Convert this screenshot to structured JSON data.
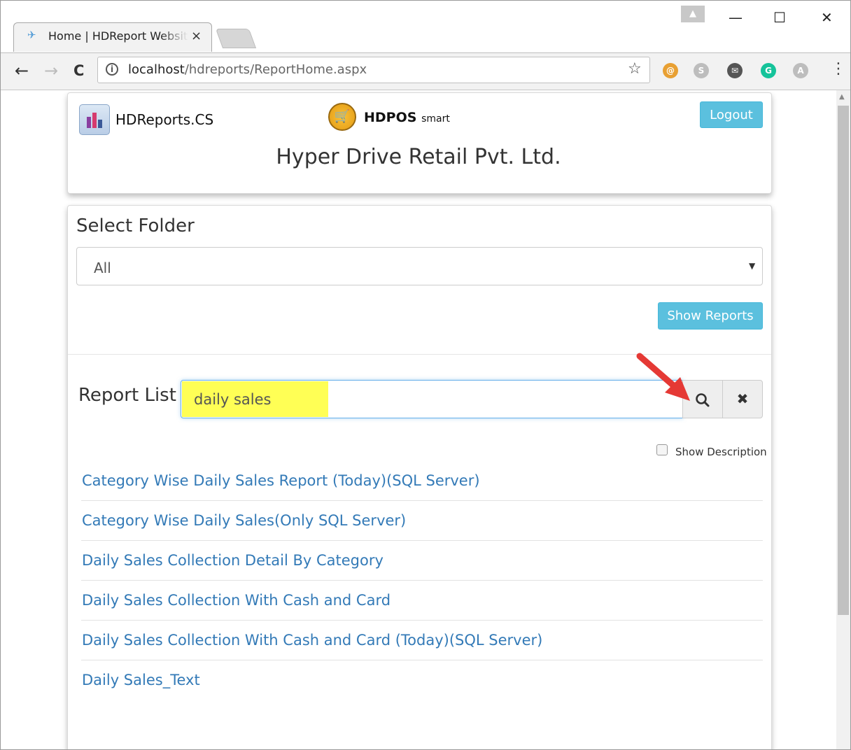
{
  "browser": {
    "tab_title": "Home | HDReport Website",
    "tab_close": "×",
    "url_host": "localhost",
    "url_path": "/hdreports/ReportHome.aspx",
    "info_glyph": "i",
    "nav": {
      "back": "←",
      "forward": "→",
      "reload": "C"
    },
    "star": "☆",
    "menu": "⋮",
    "window_buttons": {
      "minimize": "—",
      "maximize": "☐",
      "close": "✕"
    },
    "user_glyph": "▲",
    "extensions": [
      {
        "name": "extension-1-icon",
        "color": "#e8a033",
        "glyph": "@"
      },
      {
        "name": "skype-icon",
        "color": "#bdbdbd",
        "glyph": "S"
      },
      {
        "name": "mail-icon",
        "color": "#555555",
        "glyph": "✉"
      },
      {
        "name": "grammarly-icon",
        "color": "#15c39a",
        "glyph": "G"
      },
      {
        "name": "pdf-icon",
        "color": "#bdbdbd",
        "glyph": "A"
      }
    ]
  },
  "header": {
    "app_name": "HDReports.CS",
    "pos_name": "HDPOS",
    "pos_suffix": "smart",
    "logout_label": "Logout",
    "company": "Hyper Drive Retail Pvt. Ltd."
  },
  "folder": {
    "title": "Select Folder",
    "selected": "All",
    "show_reports_label": "Show Reports"
  },
  "report_list": {
    "title": "Report List",
    "search_value": "daily sales",
    "search_glyph": "🔍",
    "clear_glyph": "✖",
    "show_description_label": "Show Description",
    "items": [
      "Category Wise Daily Sales Report (Today)(SQL Server)",
      "Category Wise Daily Sales(Only SQL Server)",
      "Daily Sales Collection Detail By Category",
      "Daily Sales Collection With Cash and Card",
      "Daily Sales Collection With Cash and Card (Today)(SQL Server)",
      "Daily Sales_Text"
    ]
  },
  "colors": {
    "info_button": "#5bc0de",
    "link": "#337ab7",
    "highlight": "#ffff55",
    "arrow": "#e53935"
  }
}
